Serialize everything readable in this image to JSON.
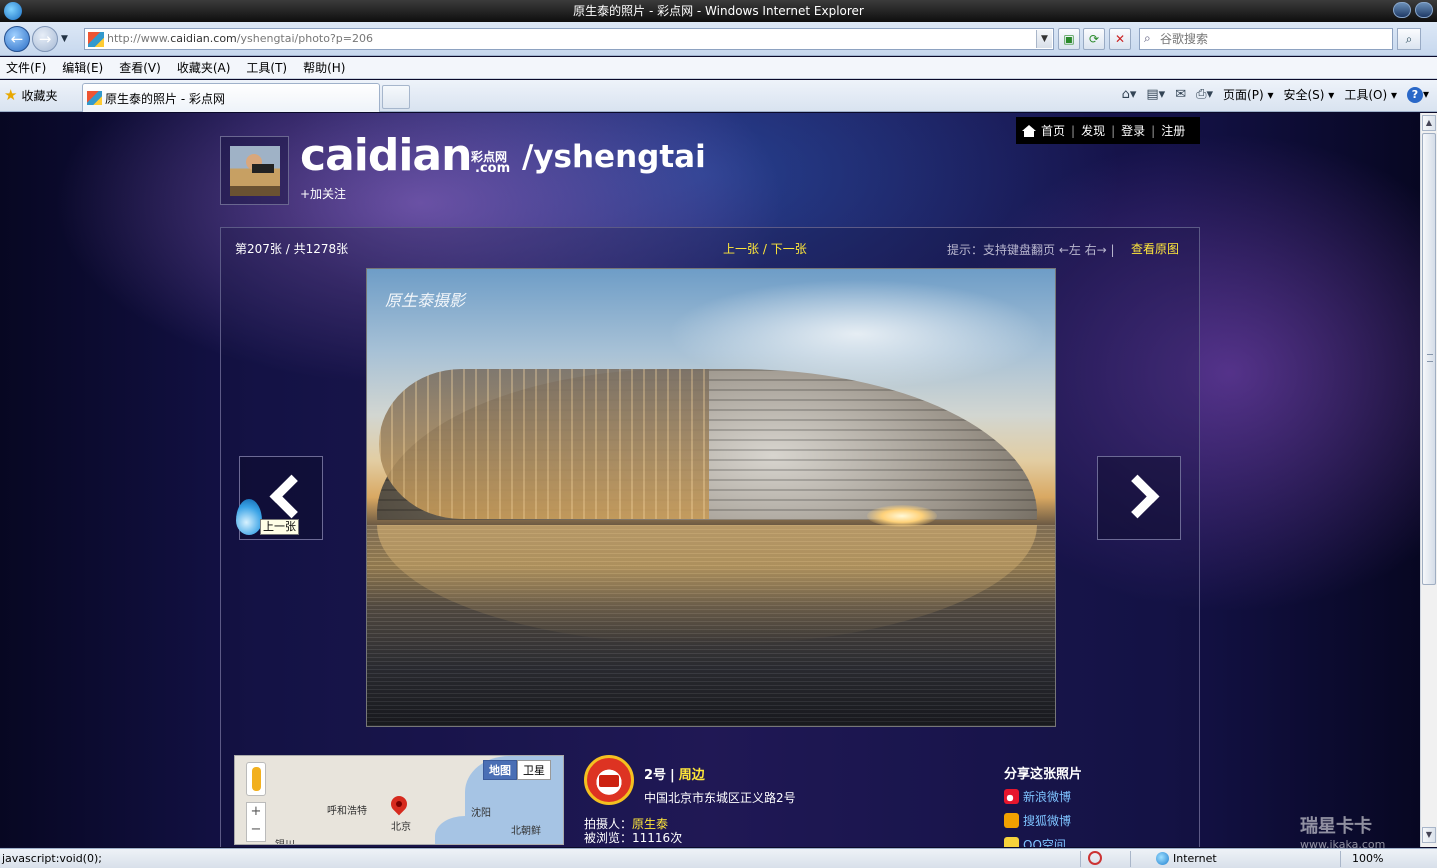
{
  "window": {
    "title": "原生泰的照片 - 彩点网 - Windows Internet Explorer"
  },
  "address": {
    "url_prefix": "http://www.",
    "url_host": "caidian.com",
    "url_path": "/yshengtai/photo?p=206"
  },
  "search": {
    "placeholder": "谷歌搜索"
  },
  "menu": [
    "文件(F)",
    "编辑(E)",
    "查看(V)",
    "收藏夹(A)",
    "工具(T)",
    "帮助(H)"
  ],
  "favorites": {
    "label": "收藏夹"
  },
  "tab": {
    "title": "原生泰的照片 - 彩点网"
  },
  "commandbar": {
    "page": "页面(P)",
    "safety": "安全(S)",
    "tools": "工具(O)"
  },
  "site_nav": {
    "home": "首页",
    "discover": "发现",
    "login": "登录",
    "register": "注册"
  },
  "header": {
    "logo": "caidian",
    "logo_sub": "彩点网",
    "logo_sub2": ".com",
    "user_path": "/yshengtai",
    "follow": "+加关注"
  },
  "viewer": {
    "counter": "第207张 / 共1278张",
    "prev": "上一张",
    "slash": " / ",
    "next": "下一张",
    "hint": "提示：支持键盘翻页 ←左 右→ |",
    "view_original": "查看原图",
    "watermark": "原生泰摄影",
    "tooltip": "上一张"
  },
  "map": {
    "tab_map": "地图",
    "tab_satellite": "卫星",
    "labels": [
      "呼和浩特",
      "北京",
      "沈阳",
      "北朝鲜",
      "银川"
    ]
  },
  "location": {
    "name": "2号",
    "separator": "|",
    "nearby": "周边",
    "address": "中国北京市东城区正义路2号",
    "photographer_label": "拍摄人：",
    "photographer": "原生泰",
    "views_label": "被浏览：",
    "views": "11116次"
  },
  "share": {
    "title": "分享这张照片",
    "items": [
      "新浪微博",
      "搜狐微博",
      "QQ空间"
    ]
  },
  "status": {
    "text": "javascript:void(0);",
    "zone": "Internet",
    "zoom": "100%"
  },
  "watermark_site": {
    "main": "瑞星卡卡",
    "sub": "www.ikaka.com"
  }
}
